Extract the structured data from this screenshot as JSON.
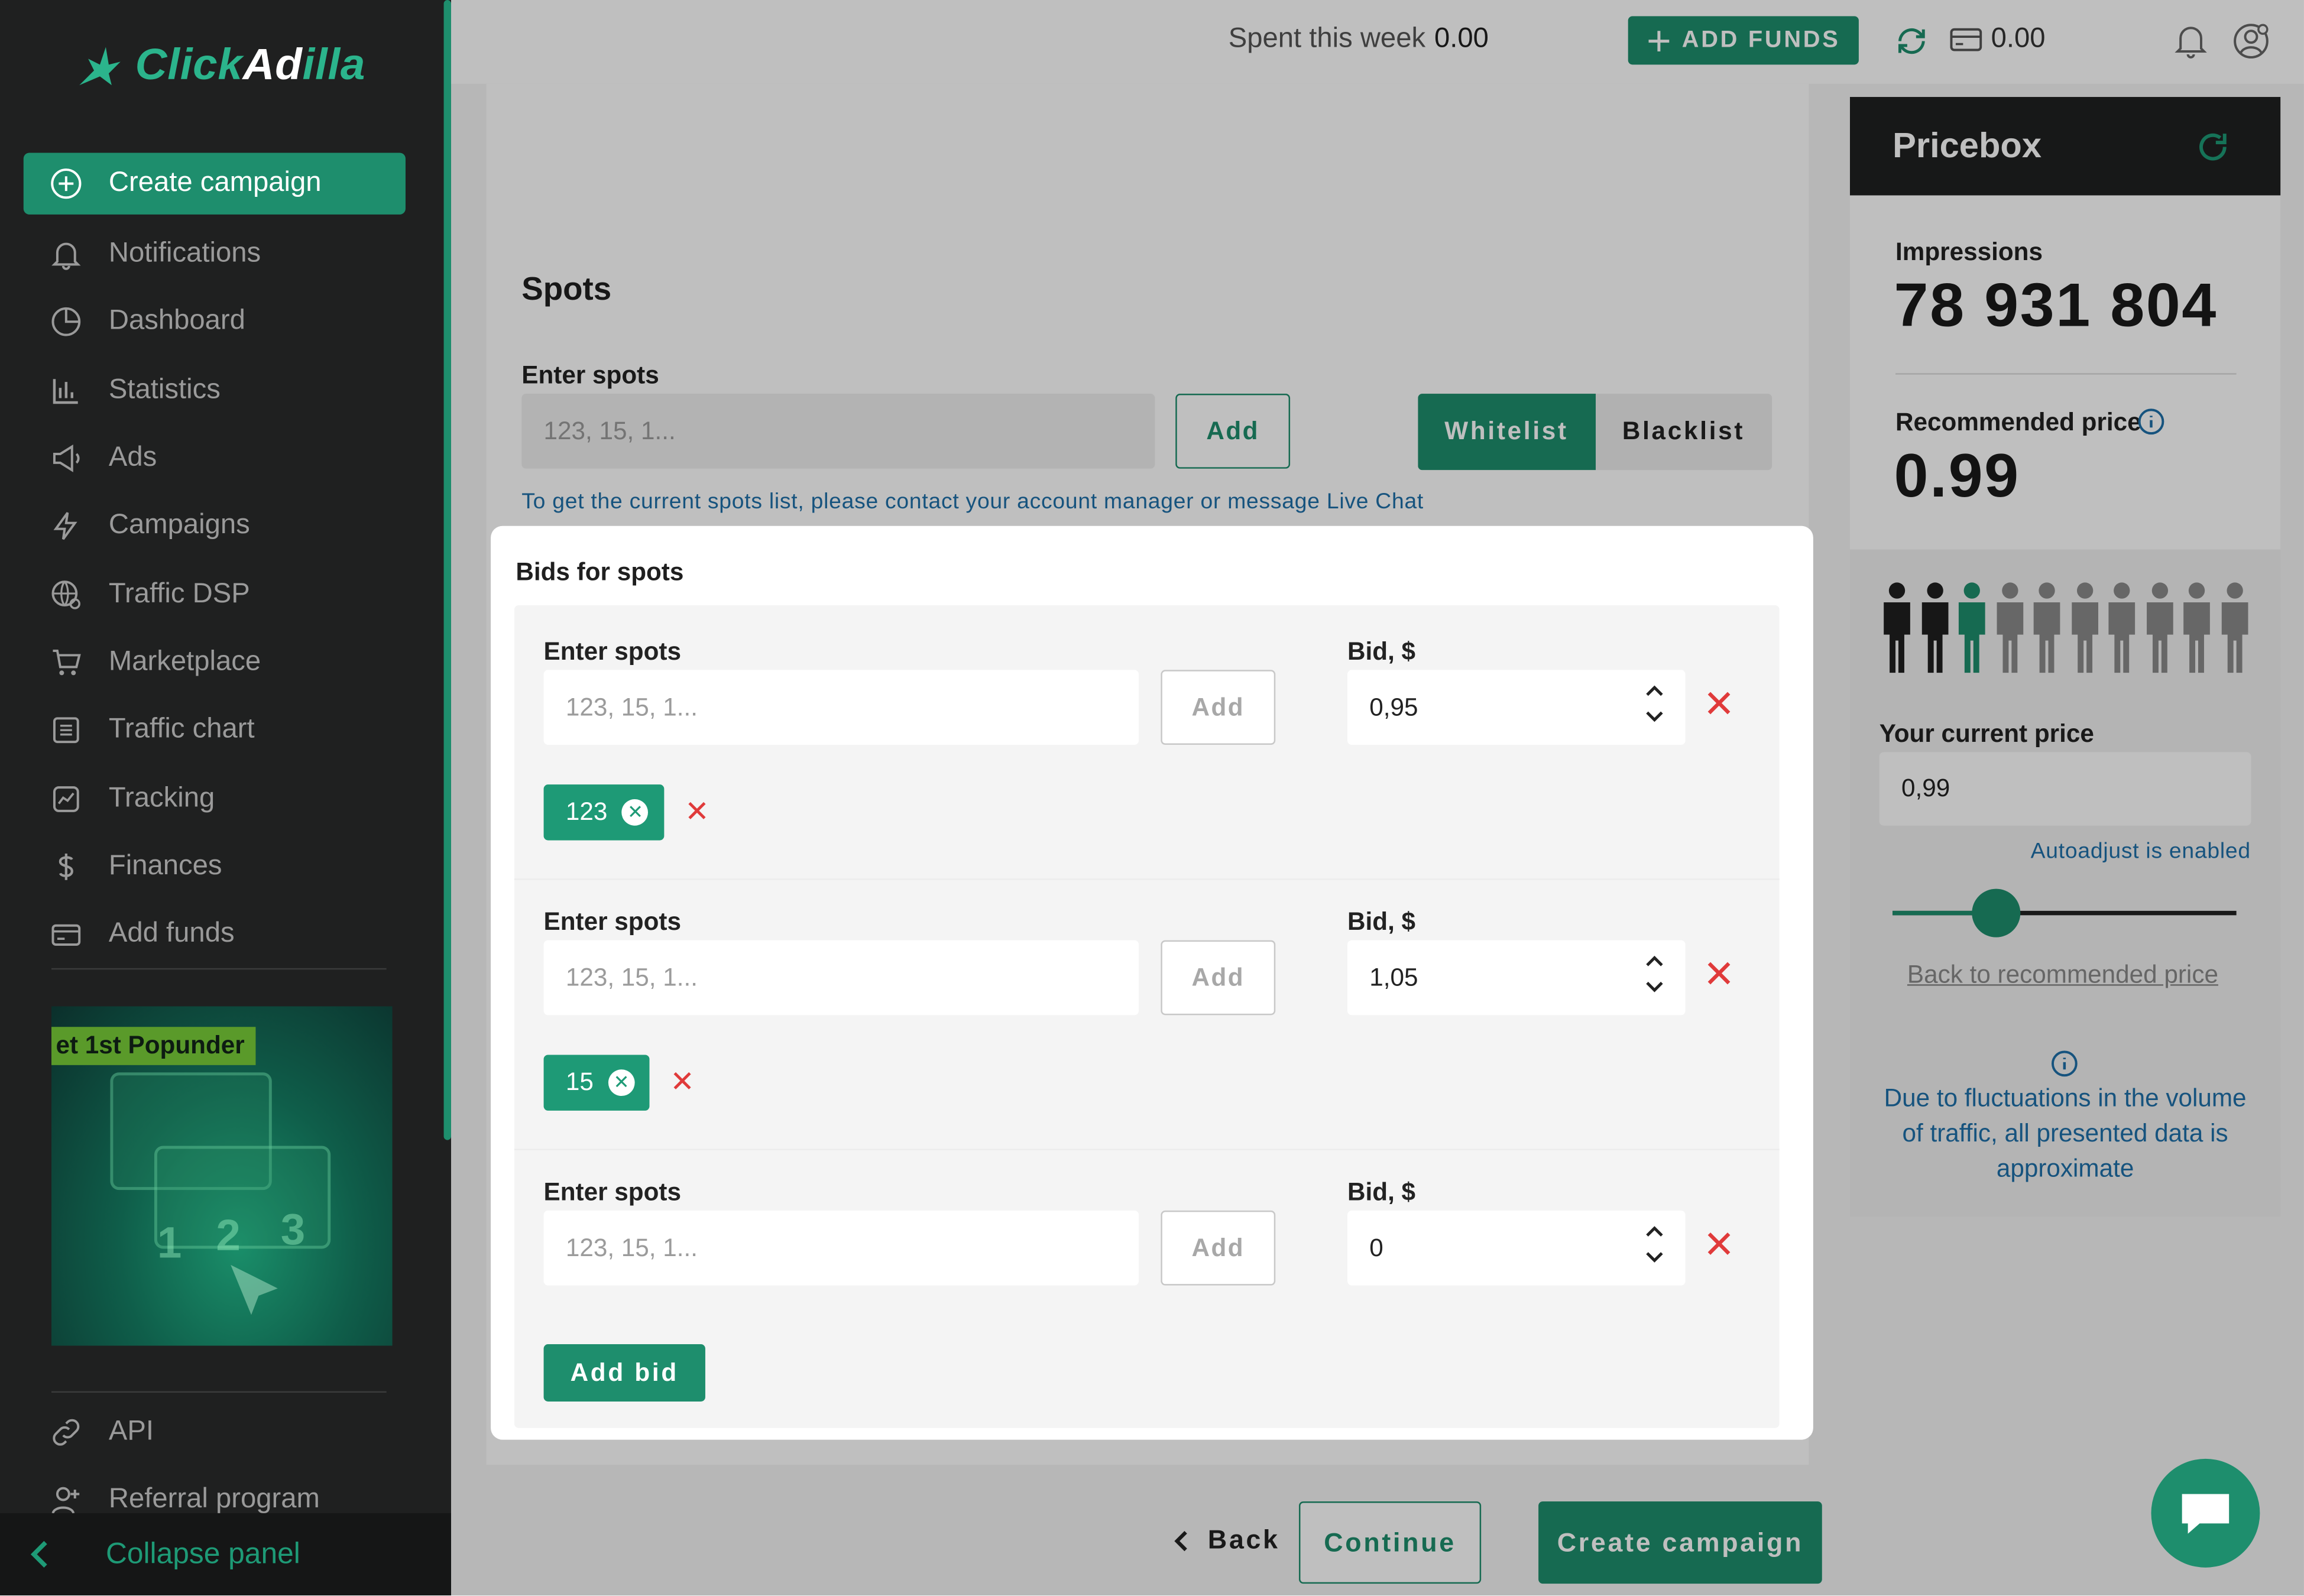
{
  "brand": {
    "part1": "Click",
    "part2": "Ad",
    "part3": "illa"
  },
  "sidebar": {
    "items": [
      {
        "label": "Create campaign",
        "icon": "plus-circle-icon"
      },
      {
        "label": "Notifications",
        "icon": "bell-icon"
      },
      {
        "label": "Dashboard",
        "icon": "pie-chart-icon"
      },
      {
        "label": "Statistics",
        "icon": "bar-chart-icon"
      },
      {
        "label": "Ads",
        "icon": "megaphone-icon"
      },
      {
        "label": "Campaigns",
        "icon": "lightning-icon"
      },
      {
        "label": "Traffic DSP",
        "icon": "globe-icon"
      },
      {
        "label": "Marketplace",
        "icon": "cart-icon"
      },
      {
        "label": "Traffic chart",
        "icon": "list-icon"
      },
      {
        "label": "Tracking",
        "icon": "trend-icon"
      },
      {
        "label": "Finances",
        "icon": "dollar-icon"
      },
      {
        "label": "Add funds",
        "icon": "card-icon"
      }
    ],
    "promo_label": "et 1st Popunder",
    "bottom_items": [
      {
        "label": "API",
        "icon": "link-icon"
      },
      {
        "label": "Referral program",
        "icon": "user-plus-icon"
      }
    ],
    "collapse_label": "Collapse panel"
  },
  "topbar": {
    "spent_label": "Spent this week",
    "spent_value": "0.00",
    "add_funds_label": "ADD FUNDS",
    "balance": "0.00"
  },
  "spots": {
    "title": "Spots",
    "enter_label": "Enter spots",
    "placeholder": "123, 15, 1...",
    "add_label": "Add",
    "whitelist_label": "Whitelist",
    "blacklist_label": "Blacklist",
    "hint": "To get the current spots list, please contact your account manager or message Live Chat"
  },
  "bids": {
    "title": "Bids for spots",
    "rows": [
      {
        "enter_label": "Enter spots",
        "placeholder": "123, 15, 1...",
        "add_label": "Add",
        "bid_label": "Bid, $",
        "bid_value": "0,95",
        "chip": "123"
      },
      {
        "enter_label": "Enter spots",
        "placeholder": "123, 15, 1...",
        "add_label": "Add",
        "bid_label": "Bid, $",
        "bid_value": "1,05",
        "chip": "15"
      },
      {
        "enter_label": "Enter spots",
        "placeholder": "123, 15, 1...",
        "add_label": "Add",
        "bid_label": "Bid, $",
        "bid_value": "0"
      }
    ],
    "add_bid_label": "Add bid"
  },
  "footer": {
    "back_label": "Back",
    "continue_label": "Continue",
    "create_label": "Create campaign"
  },
  "pricebox": {
    "title": "Pricebox",
    "impressions_label": "Impressions",
    "impressions_value": "78 931 804",
    "recommended_label": "Recommended price",
    "recommended_value": "0.99",
    "people_total": 10,
    "people_highlight_index": 2,
    "current_price_label": "Your current price",
    "current_price_value": "0,99",
    "autoadjust": "Autoadjust is enabled",
    "slider_position_pct": 30,
    "back_link": "Back to recommended price",
    "note": "Due to fluctuations in the volume of traffic, all presented data is approximate"
  },
  "colors": {
    "accent": "#1e8e6d",
    "sidebar": "#1f2020",
    "danger": "#e03a3a",
    "link": "#1e6fa8"
  }
}
